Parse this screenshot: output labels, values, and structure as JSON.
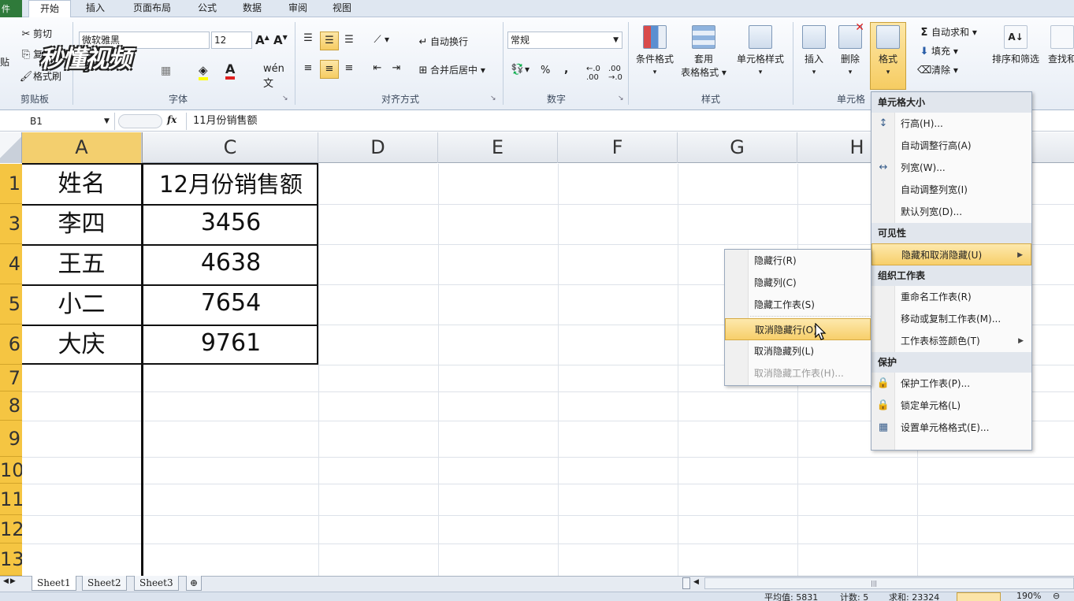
{
  "ribbon_tabs": [
    "开始",
    "插入",
    "页面布局",
    "公式",
    "数据",
    "审阅",
    "视图"
  ],
  "clipboard": {
    "cut": "剪切",
    "copy": "复",
    "painter": "格式刷",
    "paste": "贴",
    "label": "剪贴板"
  },
  "font": {
    "name": "微软雅黑",
    "size": "12",
    "label": "字体"
  },
  "align": {
    "wrap": "自动换行",
    "merge": "合并后居中",
    "label": "对齐方式"
  },
  "number": {
    "format": "常规",
    "percent": "%",
    "comma": ",",
    "label": "数字"
  },
  "styles": {
    "cond": "条件格式",
    "table1": "套用",
    "table2": "表格格式",
    "cell_style": "单元格样式",
    "label": "样式"
  },
  "cells": {
    "insert": "插入",
    "delete": "删除",
    "format": "格式",
    "label": "单元格"
  },
  "editing": {
    "autosum": "自动求和",
    "fill": "填充",
    "clear": "清除",
    "sort": "排序和筛选",
    "find": "查找和"
  },
  "watermark": "秒懂视频",
  "name_box": "B1",
  "fx": "fx",
  "formula": "11月份销售额",
  "columns": [
    "A",
    "C",
    "D",
    "E",
    "F",
    "G",
    "H"
  ],
  "rows": [
    "1",
    "3",
    "4",
    "5",
    "6",
    "7",
    "8",
    "9",
    "10",
    "11",
    "12",
    "13"
  ],
  "table": {
    "headers": [
      "姓名",
      "12月份销售额"
    ],
    "rows": [
      [
        "李四",
        "3456"
      ],
      [
        "王五",
        "4638"
      ],
      [
        "小二",
        "7654"
      ],
      [
        "大庆",
        "9761"
      ]
    ]
  },
  "sheet_tabs": [
    "Sheet1",
    "Sheet2",
    "Sheet3"
  ],
  "status_bar": {
    "average": "平均值: 5831",
    "count": "计数: 5",
    "sum": "求和: 23324",
    "zoom": "190%"
  },
  "format_menu": {
    "sections": [
      {
        "title": "单元格大小",
        "items": [
          "行高(H)...",
          "自动调整行高(A)",
          "列宽(W)...",
          "自动调整列宽(I)",
          "默认列宽(D)..."
        ]
      },
      {
        "title": "可见性",
        "items": [
          "隐藏和取消隐藏(U)"
        ]
      },
      {
        "title": "组织工作表",
        "items": [
          "重命名工作表(R)",
          "移动或复制工作表(M)...",
          "工作表标签颜色(T)"
        ]
      },
      {
        "title": "保护",
        "items": [
          "保护工作表(P)...",
          "锁定单元格(L)",
          "设置单元格格式(E)..."
        ]
      }
    ]
  },
  "submenu": {
    "items": [
      "隐藏行(R)",
      "隐藏列(C)",
      "隐藏工作表(S)",
      "取消隐藏行(O)",
      "取消隐藏列(L)",
      "取消隐藏工作表(H)..."
    ]
  }
}
